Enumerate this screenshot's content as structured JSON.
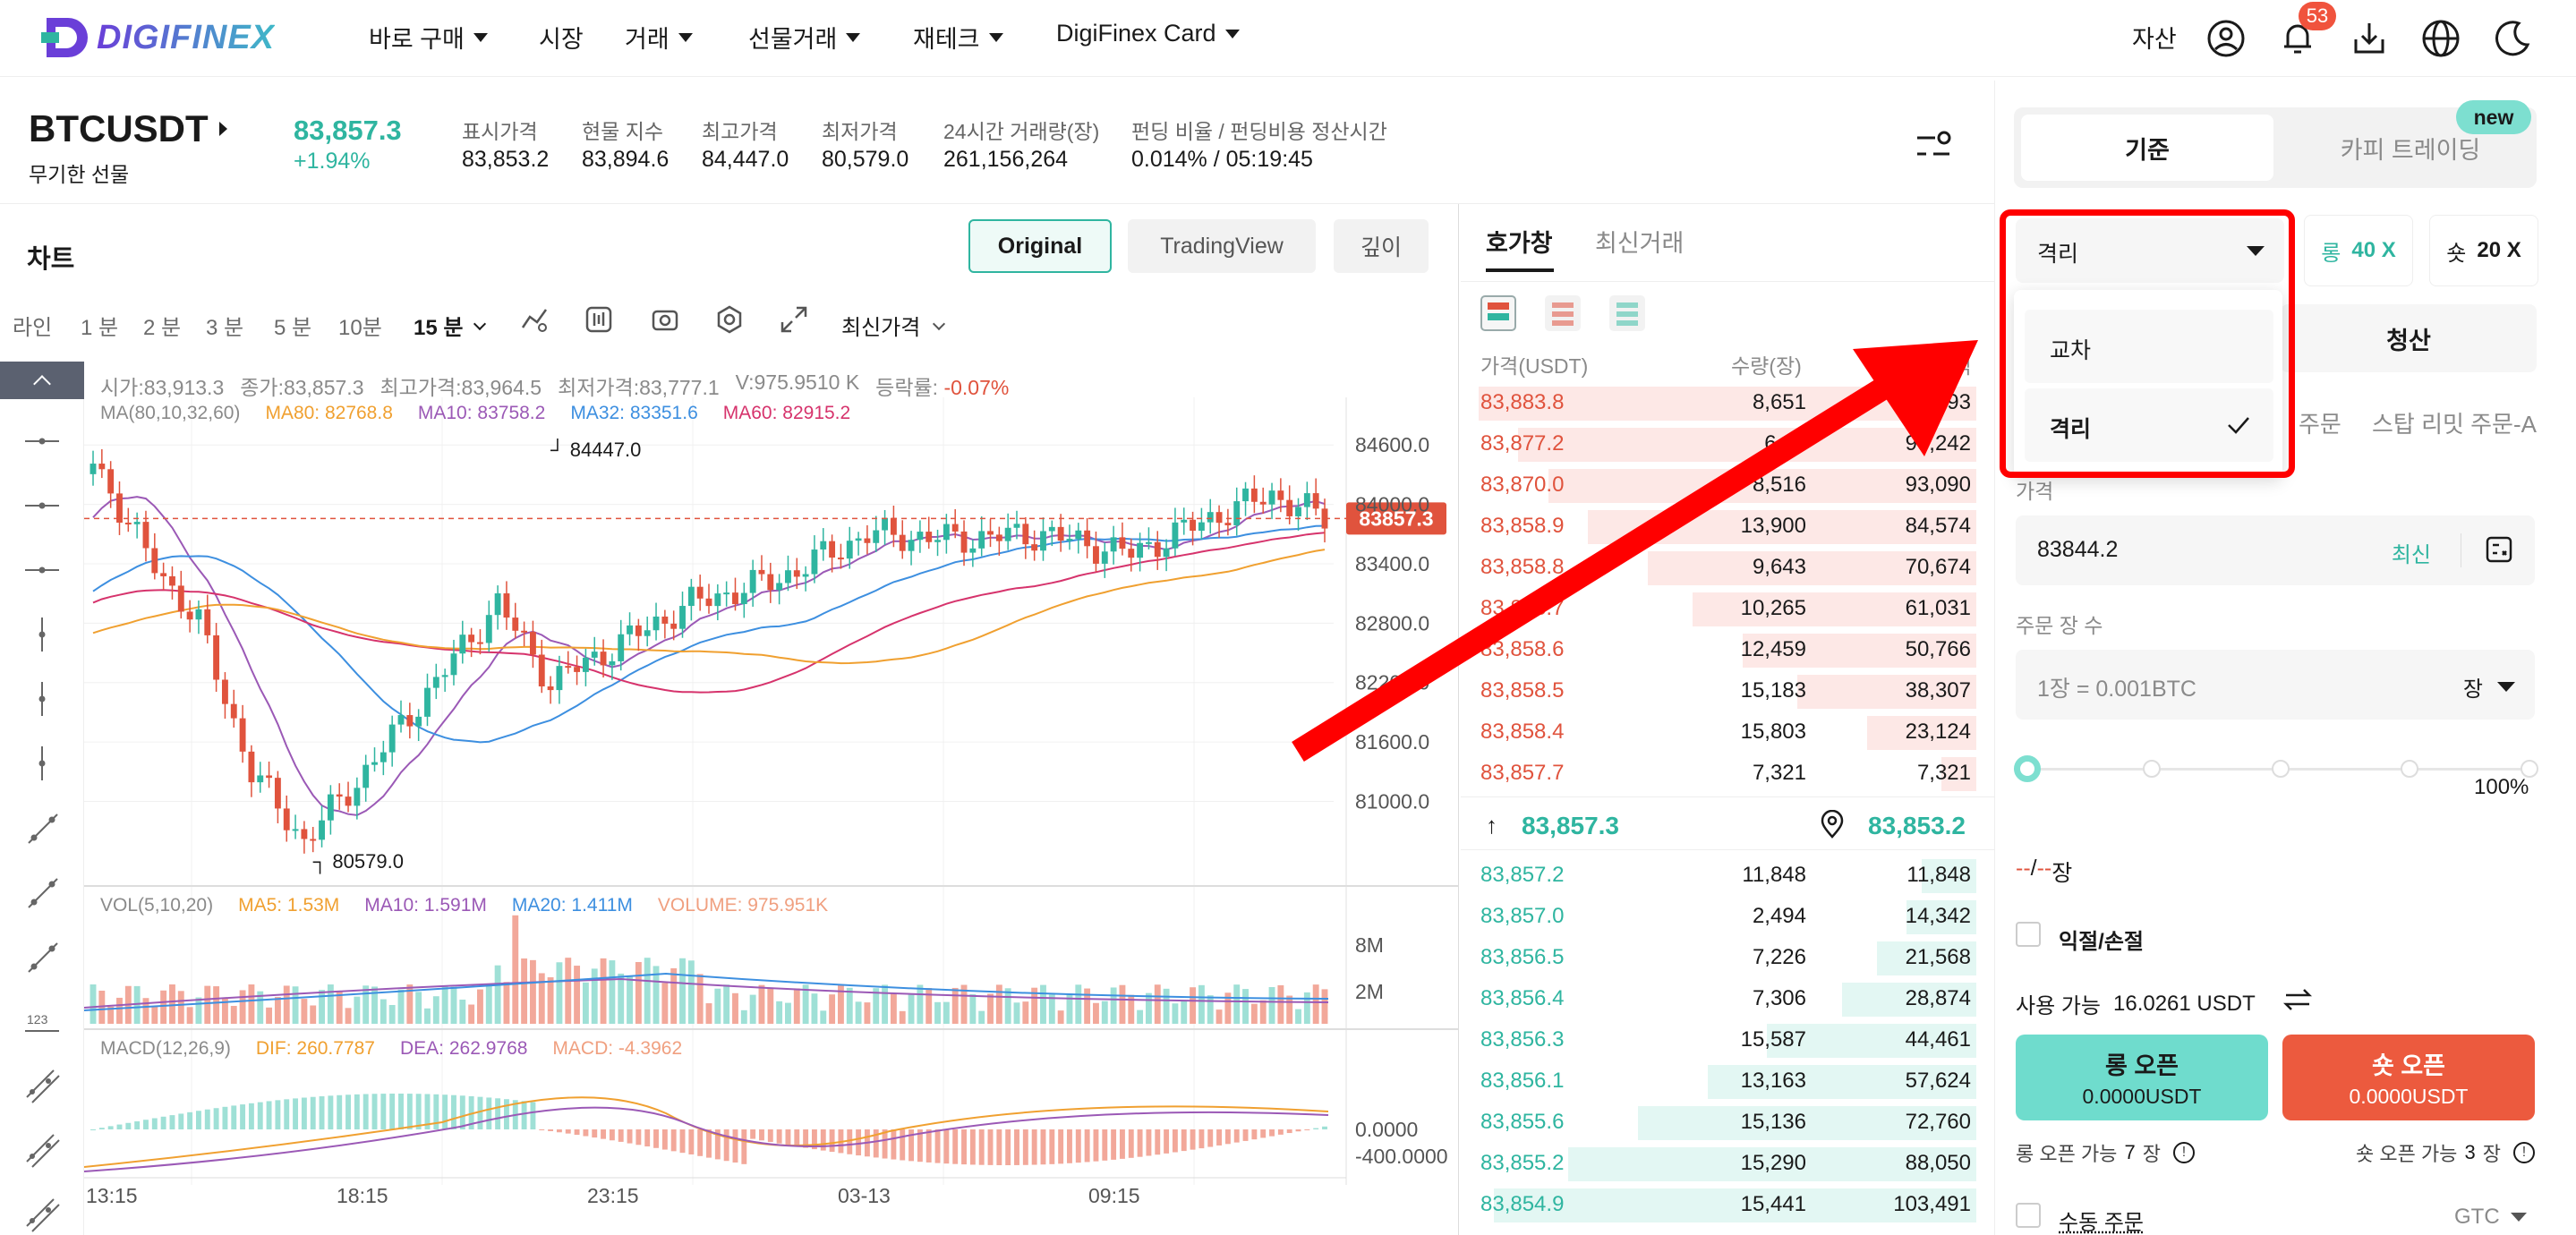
{
  "brand": {
    "logo_text": "DIGIFINEX"
  },
  "nav": {
    "items": [
      {
        "label": "바로 구매",
        "dropdown": true
      },
      {
        "label": "시장",
        "dropdown": false
      },
      {
        "label": "거래",
        "dropdown": true
      },
      {
        "label": "선물거래",
        "dropdown": true
      },
      {
        "label": "재테크",
        "dropdown": true
      },
      {
        "label": "DigiFinex Card",
        "dropdown": true
      }
    ],
    "assets_label": "자산",
    "notification_count": "53"
  },
  "ticker": {
    "symbol": "BTCUSDT",
    "subtitle": "무기한 선물",
    "last_price": "83,857.3",
    "change_pct": "+1.94%",
    "stats": [
      {
        "label": "표시가격",
        "value": "83,853.2"
      },
      {
        "label": "현물 지수",
        "value": "83,894.6"
      },
      {
        "label": "최고가격",
        "value": "84,447.0"
      },
      {
        "label": "최저가격",
        "value": "80,579.0"
      },
      {
        "label": "24시간 거래량(장)",
        "value": "261,156,264"
      },
      {
        "label": "펀딩 비율 / 펀딩비용 정산시간",
        "value": "0.014% / 05:19:45"
      }
    ]
  },
  "chart_panel": {
    "title": "차트",
    "view_tabs": [
      "Original",
      "TradingView",
      "깊이"
    ],
    "active_view": "Original",
    "timeframes": [
      "라인",
      "1 분",
      "2 분",
      "3 분",
      "5 분",
      "10분",
      "15 분"
    ],
    "active_timeframe": "15 분",
    "price_source": "최신가격",
    "ohlc": {
      "open": "시가:83,913.3",
      "close": "종가:83,857.3",
      "high": "최고가격:83,964.5",
      "low": "최저가격:83,777.1",
      "volume": "V:975.9510 K",
      "change_label": "등락률:",
      "change_value": "-0.07%"
    },
    "ma_legend": {
      "title": "MA(80,10,32,60)",
      "ma80": "MA80: 82768.8",
      "ma10": "MA10: 83758.2",
      "ma32": "MA32: 83351.6",
      "ma60": "MA60: 82915.2"
    },
    "vol_legend": {
      "title": "VOL(5,10,20)",
      "ma5": "MA5: 1.53M",
      "ma10": "MA10: 1.591M",
      "ma20": "MA20: 1.411M",
      "volume": "VOLUME: 975.951K"
    },
    "macd_legend": {
      "title": "MACD(12,26,9)",
      "dif": "DIF: 260.7787",
      "dea": "DEA: 262.9768",
      "macd": "MACD: -4.3962"
    },
    "price_axis": [
      "84600.0",
      "84000.0",
      "83400.0",
      "82800.0",
      "82200.0",
      "81600.0",
      "81000.0"
    ],
    "current_price_tag": "83857.3",
    "high_marker": "84447.0",
    "low_marker": "80579.0",
    "vol_axis": [
      "8M",
      "2M"
    ],
    "macd_axis": [
      "0.0000",
      "-400.0000"
    ],
    "time_axis": [
      "13:15",
      "18:15",
      "23:15",
      "03-13",
      "09:15"
    ]
  },
  "orderbook": {
    "tabs": [
      "호가창",
      "최신거래"
    ],
    "active_tab": "호가창",
    "columns": [
      "가격(USDT)",
      "수량(장)",
      "총액"
    ],
    "asks": [
      {
        "price": "83,883.8",
        "qty": "8,651",
        "total": "107,893",
        "depth": 1.0
      },
      {
        "price": "83,877.2",
        "qty": "6,15",
        "total": "99,242",
        "depth": 0.92
      },
      {
        "price": "83,870.0",
        "qty": "8,516",
        "total": "93,090",
        "depth": 0.86
      },
      {
        "price": "83,858.9",
        "qty": "13,900",
        "total": "84,574",
        "depth": 0.78
      },
      {
        "price": "83,858.8",
        "qty": "9,643",
        "total": "70,674",
        "depth": 0.66
      },
      {
        "price": "83,858.7",
        "qty": "10,265",
        "total": "61,031",
        "depth": 0.57
      },
      {
        "price": "83,858.6",
        "qty": "12,459",
        "total": "50,766",
        "depth": 0.47
      },
      {
        "price": "83,858.5",
        "qty": "15,183",
        "total": "38,307",
        "depth": 0.36
      },
      {
        "price": "83,858.4",
        "qty": "15,803",
        "total": "23,124",
        "depth": 0.22
      },
      {
        "price": "83,857.7",
        "qty": "7,321",
        "total": "7,321",
        "depth": 0.07
      }
    ],
    "last_price": "83,857.3",
    "mark_price": "83,853.2",
    "bids": [
      {
        "price": "83,857.2",
        "qty": "11,848",
        "total": "11,848",
        "depth": 0.11
      },
      {
        "price": "83,857.0",
        "qty": "2,494",
        "total": "14,342",
        "depth": 0.14
      },
      {
        "price": "83,856.5",
        "qty": "7,226",
        "total": "21,568",
        "depth": 0.2
      },
      {
        "price": "83,856.4",
        "qty": "7,306",
        "total": "28,874",
        "depth": 0.27
      },
      {
        "price": "83,856.3",
        "qty": "15,587",
        "total": "44,461",
        "depth": 0.42
      },
      {
        "price": "83,856.1",
        "qty": "13,163",
        "total": "57,624",
        "depth": 0.54
      },
      {
        "price": "83,855.6",
        "qty": "15,136",
        "total": "72,760",
        "depth": 0.68
      },
      {
        "price": "83,855.2",
        "qty": "15,290",
        "total": "88,050",
        "depth": 0.82
      },
      {
        "price": "83,854.9",
        "qty": "15,441",
        "total": "103,491",
        "depth": 0.97
      }
    ]
  },
  "trade_panel": {
    "tabs": [
      "기준",
      "카피 트레이딩"
    ],
    "active_tab": "기준",
    "new_badge": "new",
    "margin_mode": "격리",
    "margin_options": [
      {
        "label": "교차",
        "selected": false
      },
      {
        "label": "격리",
        "selected": true
      }
    ],
    "long_leverage_label": "롱",
    "long_leverage": "40 X",
    "short_leverage_label": "숏",
    "short_leverage": "20 X",
    "close_tab": "청산",
    "order_types_visible": [
      "주문",
      "스탑 리밋 주문-A"
    ],
    "price_label": "가격",
    "price_value": "83844.2",
    "price_latest": "최신",
    "qty_label": "주문 장 수",
    "qty_placeholder": "1장 = 0.001BTC",
    "qty_unit": "장",
    "slider_max_label": "100%",
    "slider_value_pct": 0,
    "position_dash_a": "--",
    "position_slash": "/",
    "position_dash_b": "--",
    "position_unit": "장",
    "tpsl_label": "익절/손절",
    "available_label": "사용 가능",
    "available_value": "16.0261 USDT",
    "long_open_label": "롱 오픈",
    "long_open_value": "0.0000USDT",
    "short_open_label": "숏 오픈",
    "short_open_value": "0.0000USDT",
    "long_capacity_label": "롱 오픈 가능",
    "long_capacity_value": "7",
    "long_capacity_unit": "장",
    "short_capacity_label": "숏 오픈 가능",
    "short_capacity_value": "3",
    "short_capacity_unit": "장",
    "manual_order_label": "수동 주문",
    "gtc_label": "GTC"
  },
  "colors": {
    "up": "#2fb5a0",
    "down": "#e0533d",
    "annotation": "#ff0000",
    "ma10": "#9b59b6",
    "ma32": "#3d8fe0",
    "ma60": "#d6336c",
    "ma80": "#f0a030"
  }
}
